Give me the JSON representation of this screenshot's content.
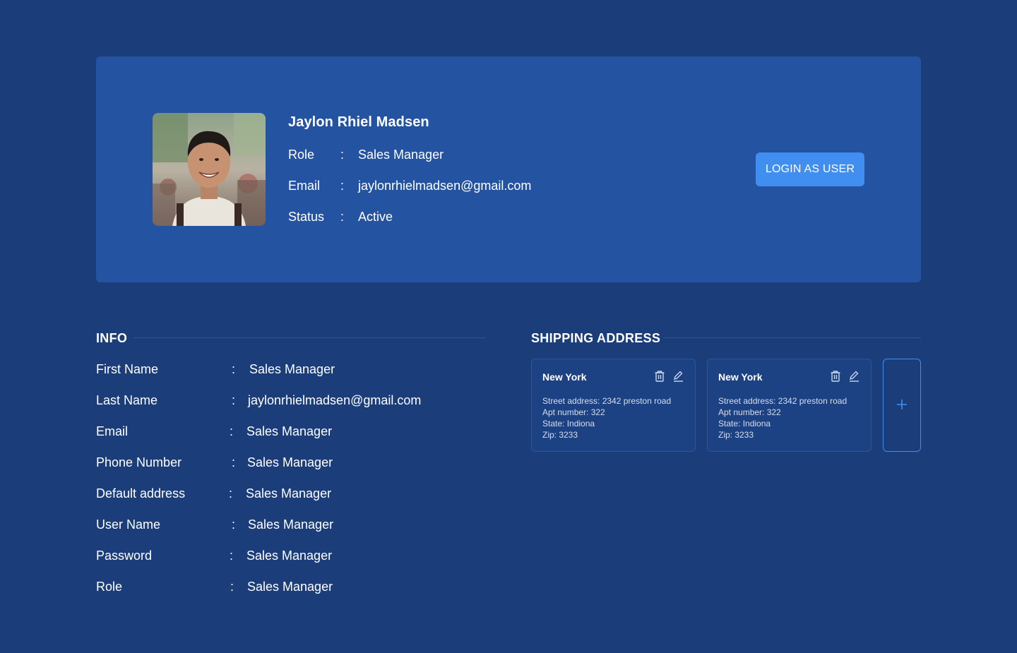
{
  "profile": {
    "name": "Jaylon Rhiel Madsen",
    "rows": [
      {
        "label": "Role",
        "value": "Sales Manager"
      },
      {
        "label": "Email",
        "value": "jaylonrhielmadsen@gmail.com"
      },
      {
        "label": "Status",
        "value": "Active"
      }
    ],
    "login_button": "LOGIN AS USER"
  },
  "info": {
    "title": "INFO",
    "rows": [
      {
        "label": "First Name",
        "value": "Sales Manager"
      },
      {
        "label": "Last Name",
        "value": "jaylonrhielmadsen@gmail.com"
      },
      {
        "label": "Email",
        "value": "Sales Manager"
      },
      {
        "label": "Phone Number",
        "value": "Sales Manager"
      },
      {
        "label": "Default address",
        "value": "Sales Manager"
      },
      {
        "label": "User Name",
        "value": "Sales Manager"
      },
      {
        "label": "Password",
        "value": "Sales Manager"
      },
      {
        "label": "Role",
        "value": "Sales Manager"
      }
    ]
  },
  "separator": ":",
  "shipping": {
    "title": "SHIPPING ADDRESS",
    "add_icon": "plus-icon",
    "addresses": [
      {
        "city": "New York",
        "street": "Street address: 2342 preston road",
        "apt": "Apt number: 322",
        "state": "State: Indiona",
        "zip": "Zip: 3233"
      },
      {
        "city": "New York",
        "street": "Street address: 2342 preston road",
        "apt": "Apt number: 322",
        "state": "State: Indiona",
        "zip": "Zip: 3233"
      }
    ]
  },
  "colors": {
    "background": "#1b3e7b",
    "card": "#2353a1",
    "accent": "#3f8ef0"
  }
}
